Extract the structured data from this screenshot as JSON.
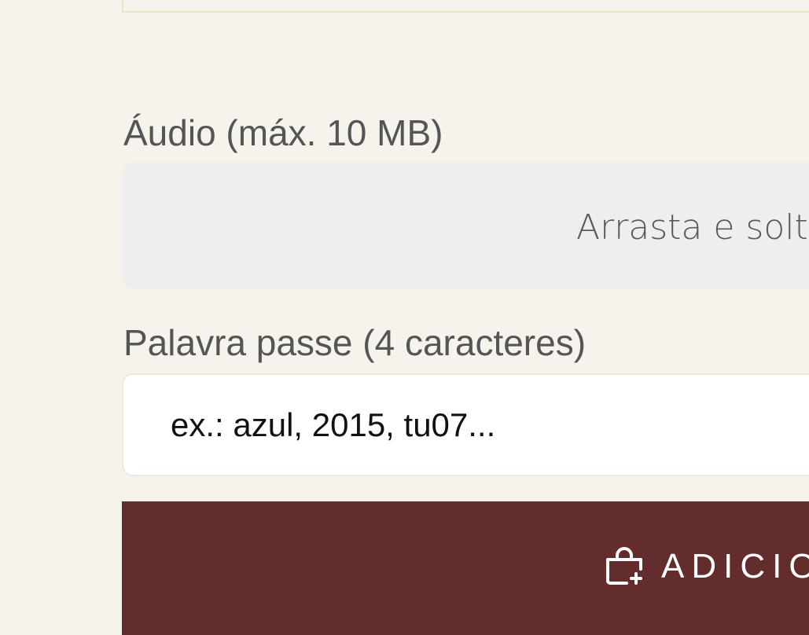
{
  "form": {
    "audio_label": "Áudio (máx. 10 MB)",
    "dropzone_text": "Arrasta e solt",
    "password_label": "Palavra passe (4 caracteres)",
    "password_placeholder": "ex.: azul, 2015, tu07...",
    "submit_label": "ADICIO",
    "submit_icon": "shopping-bag-plus-icon"
  },
  "colors": {
    "background": "#f6f3ec",
    "dropzone": "#eeeeee",
    "button": "#632d2d",
    "label_text": "#555555"
  }
}
